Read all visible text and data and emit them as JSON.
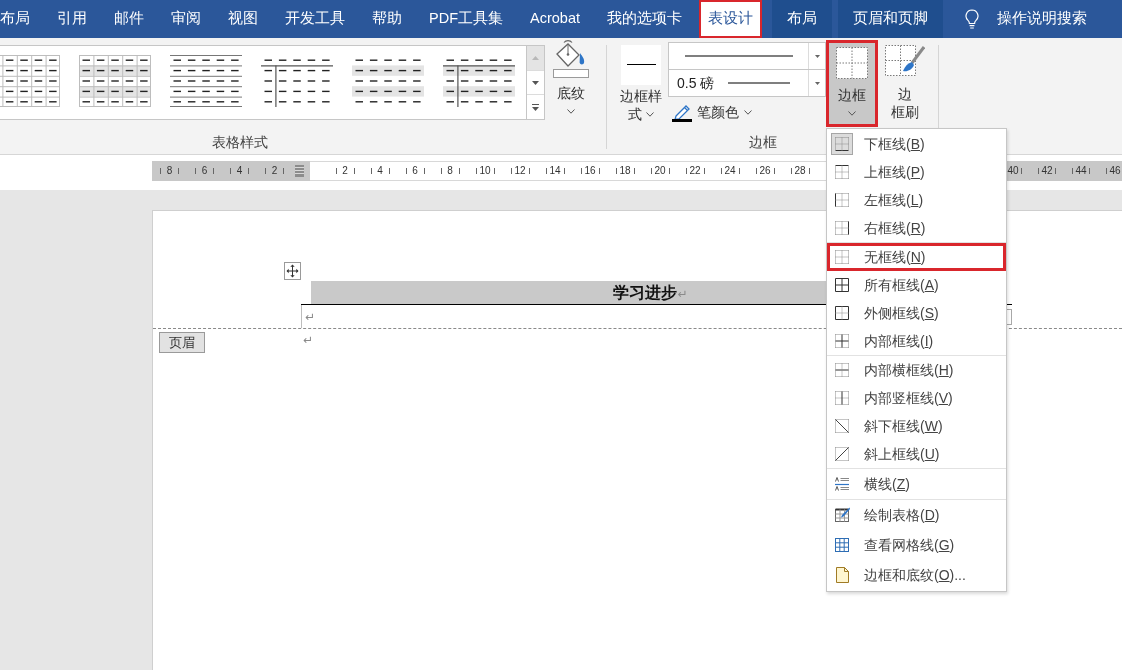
{
  "tabs": [
    {
      "label": "布局",
      "selected": false,
      "contextual": false,
      "highlighted": false
    },
    {
      "label": "引用",
      "selected": false,
      "contextual": false,
      "highlighted": false
    },
    {
      "label": "邮件",
      "selected": false,
      "contextual": false,
      "highlighted": false
    },
    {
      "label": "审阅",
      "selected": false,
      "contextual": false,
      "highlighted": false
    },
    {
      "label": "视图",
      "selected": false,
      "contextual": false,
      "highlighted": false
    },
    {
      "label": "开发工具",
      "selected": false,
      "contextual": false,
      "highlighted": false
    },
    {
      "label": "帮助",
      "selected": false,
      "contextual": false,
      "highlighted": false
    },
    {
      "label": "PDF工具集",
      "selected": false,
      "contextual": false,
      "highlighted": false
    },
    {
      "label": "Acrobat",
      "selected": false,
      "contextual": false,
      "highlighted": false
    },
    {
      "label": "我的选项卡",
      "selected": false,
      "contextual": false,
      "highlighted": false
    },
    {
      "label": "表设计",
      "selected": true,
      "contextual": false,
      "highlighted": true
    },
    {
      "label": "布局",
      "selected": false,
      "contextual": true,
      "highlighted": false
    },
    {
      "label": "页眉和页脚",
      "selected": false,
      "contextual": true,
      "highlighted": false
    }
  ],
  "search": {
    "label": "操作说明搜索"
  },
  "ribbon": {
    "table_styles": {
      "label": "表格样式",
      "styles": [
        {
          "kind": "grid"
        },
        {
          "kind": "banded_grid"
        },
        {
          "kind": "lines"
        },
        {
          "kind": "header_column"
        },
        {
          "kind": "banded"
        },
        {
          "kind": "header_column_banded"
        }
      ],
      "scroll_buttons": [
        {
          "kind": "up",
          "disabled": true
        },
        {
          "kind": "down",
          "disabled": false
        },
        {
          "kind": "more",
          "disabled": false
        }
      ]
    },
    "shading": {
      "label": "底纹"
    },
    "borders": {
      "label": "边框",
      "style_button": {
        "lines": [
          "边框样",
          "式"
        ]
      },
      "weight": {
        "value": "0.5 磅"
      },
      "pen_color": {
        "label": "笔颜色"
      },
      "borders_button": {
        "label": "边框",
        "expanded": true,
        "highlighted": true
      },
      "painter": {
        "lines": [
          "边",
          "框刷"
        ]
      }
    }
  },
  "ruler": {
    "left_numbers": [
      "8",
      "6",
      "4",
      "2"
    ],
    "numbers": [
      "2",
      "4",
      "6",
      "8",
      "10",
      "12",
      "14",
      "16",
      "18",
      "20",
      "22",
      "24",
      "26",
      "28"
    ],
    "right_numbers": [
      "40",
      "42",
      "44",
      "46"
    ]
  },
  "document": {
    "table": {
      "header": "学习进步",
      "header_mark": "↵",
      "row_mark": "↵"
    },
    "header_tag": "页眉",
    "body_mark": "↵"
  },
  "menu": {
    "groups": [
      {
        "items": [
          {
            "text": "下框线(",
            "key": "B",
            "text_end": ")",
            "kind": "bottom",
            "selected": true,
            "highlighted": false
          },
          {
            "text": "上框线(",
            "key": "P",
            "text_end": ")",
            "kind": "top",
            "selected": false,
            "highlighted": false
          },
          {
            "text": "左框线(",
            "key": "L",
            "text_end": ")",
            "kind": "left",
            "selected": false,
            "highlighted": false
          },
          {
            "text": "右框线(",
            "key": "R",
            "text_end": ")",
            "kind": "right",
            "selected": false,
            "highlighted": false
          }
        ]
      },
      {
        "items": [
          {
            "text": "无框线(",
            "key": "N",
            "text_end": ")",
            "kind": "none",
            "selected": false,
            "highlighted": true
          },
          {
            "text": "所有框线(",
            "key": "A",
            "text_end": ")",
            "kind": "all",
            "selected": false,
            "highlighted": false
          },
          {
            "text": "外侧框线(",
            "key": "S",
            "text_end": ")",
            "kind": "outside",
            "selected": false,
            "highlighted": false
          },
          {
            "text": "内部框线(",
            "key": "I",
            "text_end": ")",
            "kind": "inside",
            "selected": false,
            "highlighted": false
          }
        ]
      },
      {
        "items": [
          {
            "text": "内部横框线(",
            "key": "H",
            "text_end": ")",
            "kind": "inside_h",
            "selected": false,
            "highlighted": false
          },
          {
            "text": "内部竖框线(",
            "key": "V",
            "text_end": ")",
            "kind": "inside_v",
            "selected": false,
            "highlighted": false
          },
          {
            "text": "斜下框线(",
            "key": "W",
            "text_end": ")",
            "kind": "diag_down",
            "selected": false,
            "highlighted": false
          },
          {
            "text": "斜上框线(",
            "key": "U",
            "text_end": ")",
            "kind": "diag_up",
            "selected": false,
            "highlighted": false
          }
        ]
      },
      {
        "items": [
          {
            "text": "横线(",
            "key": "Z",
            "text_end": ")",
            "kind": "hline",
            "selected": false,
            "highlighted": false
          }
        ]
      },
      {
        "items": [
          {
            "text": "绘制表格(",
            "key": "D",
            "text_end": ")",
            "kind": "draw_table",
            "selected": false,
            "highlighted": false
          },
          {
            "text": "查看网格线(",
            "key": "G",
            "text_end": ")",
            "kind": "gridlines",
            "selected": false,
            "highlighted": false
          },
          {
            "text": "边框和底纹(",
            "key": "O",
            "text_end": ")...",
            "kind": "borders_shading",
            "selected": false,
            "highlighted": false
          }
        ]
      }
    ]
  }
}
